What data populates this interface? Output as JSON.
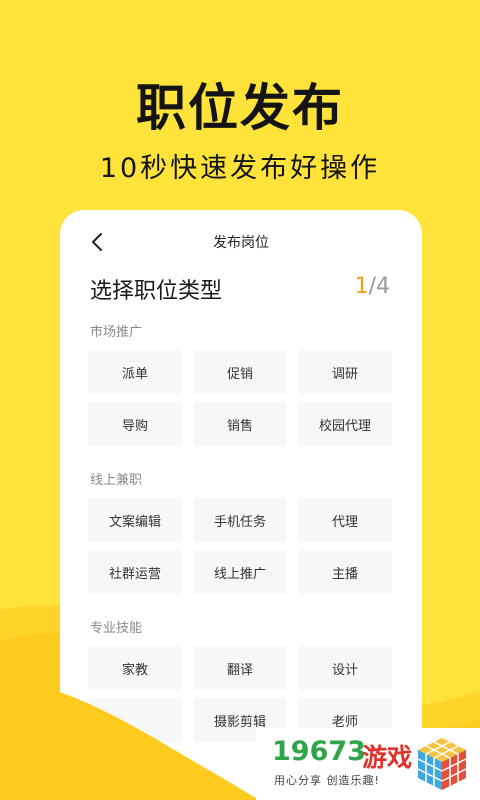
{
  "headline": "职位发布",
  "subline": "10秒快速发布好操作",
  "card": {
    "title": "发布岗位",
    "heading": "选择职位类型",
    "step_current": "1",
    "step_total": "/4"
  },
  "sections": [
    {
      "label": "市场推广",
      "items": [
        "派单",
        "促销",
        "调研",
        "导购",
        "销售",
        "校园代理"
      ]
    },
    {
      "label": "线上兼职",
      "items": [
        "文案编辑",
        "手机任务",
        "代理",
        "社群运营",
        "线上推广",
        "主播"
      ]
    },
    {
      "label": "专业技能",
      "items": [
        "家教",
        "翻译",
        "设计",
        "",
        "摄影剪辑",
        "老师"
      ]
    }
  ],
  "watermark": {
    "number": "19673",
    "name": "游戏",
    "slogan": "用心分享 创造乐趣!"
  },
  "colors": {
    "background": "#FFE23A",
    "wave": "#FFCB1F",
    "accent": "#E8A21A",
    "chip": "#F6F7F9"
  }
}
